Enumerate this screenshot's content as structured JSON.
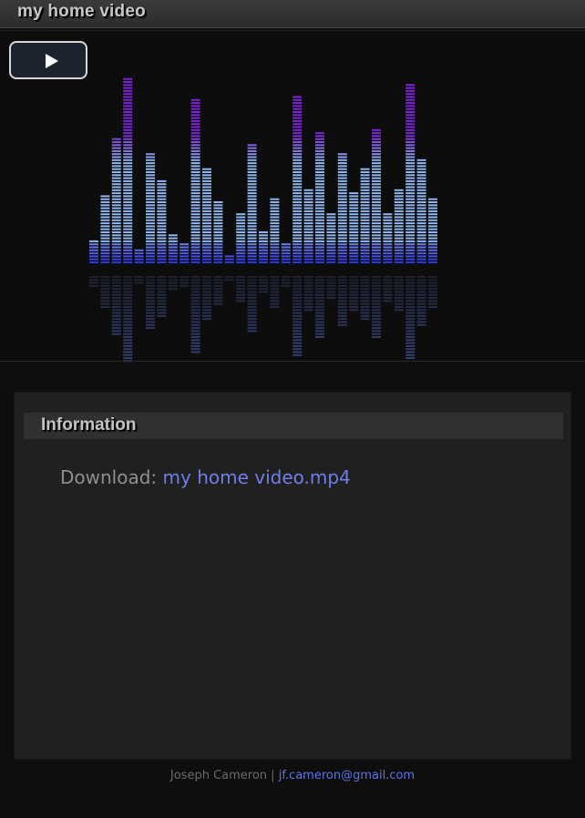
{
  "header": {
    "title": "my home video"
  },
  "player": {
    "play_icon": "play-icon",
    "equalizer_levels": [
      0.13,
      0.37,
      0.68,
      1.0,
      0.09,
      0.6,
      0.46,
      0.17,
      0.11,
      0.88,
      0.52,
      0.34,
      0.05,
      0.28,
      0.65,
      0.18,
      0.35,
      0.12,
      0.91,
      0.4,
      0.71,
      0.27,
      0.59,
      0.39,
      0.52,
      0.72,
      0.28,
      0.41,
      0.96,
      0.57,
      0.35
    ],
    "colors": {
      "top": "#7b24d6",
      "mid": "#8fb6ee",
      "bottom": "#2a2edc"
    }
  },
  "info": {
    "title": "Information",
    "download_label": "Download: ",
    "download_file": "my home video.mp4"
  },
  "footer": {
    "name": "Joseph Cameron",
    "separator": " | ",
    "email": "jf.cameron@gmail.com"
  }
}
